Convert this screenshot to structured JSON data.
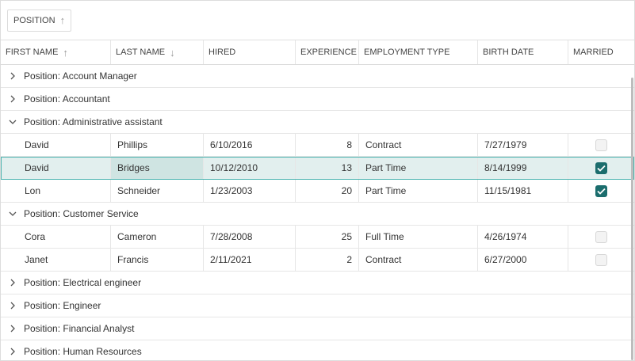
{
  "group_panel": {
    "chip_label": "POSITION"
  },
  "columns": [
    {
      "label": "FIRST NAME",
      "sort": "asc"
    },
    {
      "label": "LAST NAME",
      "sort": "desc"
    },
    {
      "label": "HIRED"
    },
    {
      "label": "EXPERIENCE"
    },
    {
      "label": "EMPLOYMENT TYPE"
    },
    {
      "label": "BIRTH DATE"
    },
    {
      "label": "MARRIED"
    }
  ],
  "groups": [
    {
      "label": "Position: Account Manager",
      "expanded": false
    },
    {
      "label": "Position: Accountant",
      "expanded": false
    },
    {
      "label": "Position: Administrative assistant",
      "expanded": true
    },
    {
      "label": "Position: Customer Service",
      "expanded": true
    },
    {
      "label": "Position: Electrical engineer",
      "expanded": false
    },
    {
      "label": "Position: Engineer",
      "expanded": false
    },
    {
      "label": "Position: Financial Analyst",
      "expanded": false
    },
    {
      "label": "Position: Human Resources",
      "expanded": false
    }
  ],
  "rows": [
    {
      "first": "David",
      "last": "Phillips",
      "hired": "6/10/2016",
      "experience": "8",
      "type": "Contract",
      "birth": "7/27/1979",
      "married": false
    },
    {
      "first": "David",
      "last": "Bridges",
      "hired": "10/12/2010",
      "experience": "13",
      "type": "Part Time",
      "birth": "8/14/1999",
      "married": true,
      "selected": true
    },
    {
      "first": "Lon",
      "last": "Schneider",
      "hired": "1/23/2003",
      "experience": "20",
      "type": "Part Time",
      "birth": "11/15/1981",
      "married": true
    },
    {
      "first": "Cora",
      "last": "Cameron",
      "hired": "7/28/2008",
      "experience": "25",
      "type": "Full Time",
      "birth": "4/26/1974",
      "married": false
    },
    {
      "first": "Janet",
      "last": "Francis",
      "hired": "2/11/2021",
      "experience": "2",
      "type": "Contract",
      "birth": "6/27/2000",
      "married": false
    }
  ],
  "colors": {
    "accent": "#1b6d6d",
    "selection_bg": "#e2efee",
    "selection_border": "#4db4b0"
  }
}
